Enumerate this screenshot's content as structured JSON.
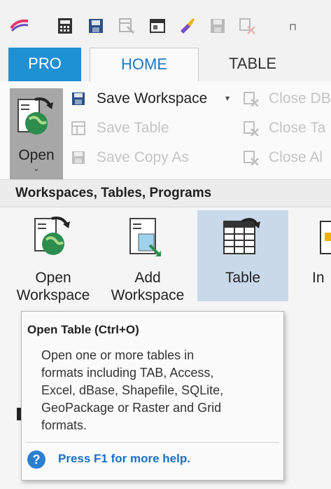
{
  "colors": {
    "accent": "#1e90d4",
    "selected": "#cad9ea",
    "open_button_bg": "#a7a7a7",
    "help_link": "#1a6fc4"
  },
  "quick_access": {
    "icons": [
      "calculator-icon",
      "save-window-icon",
      "table-edit-icon",
      "window-icon",
      "brush-icon",
      "floppy-icon",
      "close-x-icon"
    ],
    "more_label": "⊓"
  },
  "tabs": [
    {
      "label": "PRO",
      "active": false
    },
    {
      "label": "HOME",
      "active": true
    },
    {
      "label": "TABLE",
      "active": false
    }
  ],
  "ribbon": {
    "open_label": "Open",
    "open_caret": "⌄",
    "file_items": [
      {
        "label": "Save Workspace",
        "enabled": true,
        "dropdown": "▾",
        "icon": "save-workspace-icon"
      },
      {
        "label": "Save Table",
        "enabled": false,
        "icon": "save-table-icon"
      },
      {
        "label": "Save Copy As",
        "enabled": false,
        "icon": "save-copy-icon"
      }
    ],
    "close_items": [
      {
        "label": "Close DB",
        "icon": "close-db-icon"
      },
      {
        "label": "Close Ta",
        "icon": "close-table-icon"
      },
      {
        "label": "Close Al",
        "icon": "close-all-icon"
      }
    ]
  },
  "group": {
    "title": "Workspaces, Tables, Programs",
    "buttons": [
      {
        "line1": "Open",
        "line2": "Workspace",
        "icon": "open-workspace-icon"
      },
      {
        "line1": "Add",
        "line2": "Workspace",
        "icon": "add-workspace-icon"
      },
      {
        "line1": "Table",
        "line2": "",
        "icon": "table-icon",
        "selected": true
      },
      {
        "line1": "In",
        "line2": "",
        "icon": "partial-icon"
      }
    ]
  },
  "tooltip": {
    "title": "Open Table  (Ctrl+O)",
    "lines": [
      "Open one or more tables in",
      "formats including TAB, Access,",
      "Excel, dBase, Shapefile, SQLite,",
      "GeoPackage or Raster and Grid",
      "formats."
    ],
    "help_icon": "?",
    "help_text": "Press F1 for more help."
  }
}
